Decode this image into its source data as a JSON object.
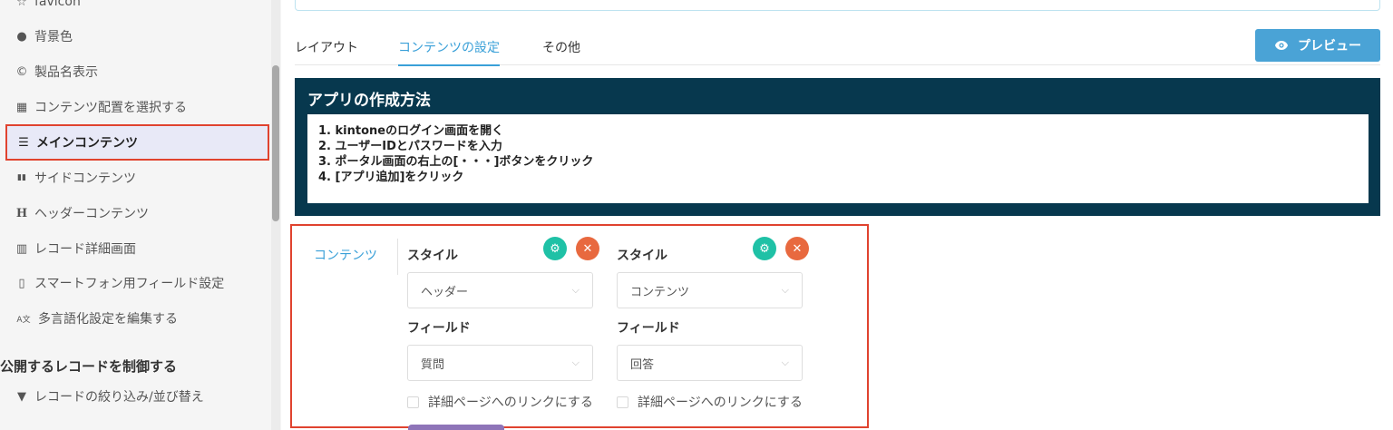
{
  "sidebar": {
    "items": [
      {
        "icon": "star-icon",
        "glyph": "☆",
        "label": "favicon"
      },
      {
        "icon": "droplet-icon",
        "glyph": "●",
        "label": "背景色"
      },
      {
        "icon": "copyright-icon",
        "glyph": "©",
        "label": "製品名表示"
      },
      {
        "icon": "grid-icon",
        "glyph": "▦",
        "label": "コンテンツ配置を選択する"
      },
      {
        "icon": "list-icon",
        "glyph": "☰",
        "label": "メインコンテンツ"
      },
      {
        "icon": "columns-icon",
        "glyph": "▮▮",
        "label": "サイドコンテンツ"
      },
      {
        "icon": "heading-icon",
        "glyph": "H",
        "label": "ヘッダーコンテンツ"
      },
      {
        "icon": "table-icon",
        "glyph": "▥",
        "label": "レコード詳細画面"
      },
      {
        "icon": "mobile-icon",
        "glyph": "▯",
        "label": "スマートフォン用フィールド設定"
      },
      {
        "icon": "translate-icon",
        "glyph": "A文",
        "label": "多言語化設定を編集する"
      }
    ],
    "section_heading": "公開するレコードを制御する",
    "filter_item": {
      "icon": "filter-icon",
      "glyph": "▼",
      "label": "レコードの絞り込み/並び替え"
    }
  },
  "tabs": [
    {
      "label": "レイアウト"
    },
    {
      "label": "コンテンツの設定"
    },
    {
      "label": "その他"
    }
  ],
  "preview_button": {
    "icon": "eye-icon",
    "label": "プレビュー"
  },
  "info": {
    "title": "アプリの作成方法",
    "steps": [
      "1. kintoneのログイン画面を開く",
      "2. ユーザーIDとパスワードを入力",
      "3. ポータル画面の右上の[・・・]ボタンをクリック",
      "4. [アプリ追加]をクリック"
    ]
  },
  "editor": {
    "label": "コンテンツ",
    "columns": [
      {
        "style_label": "スタイル",
        "style_value": "ヘッダー",
        "field_label": "フィールド",
        "field_value": "質問",
        "link_label": "詳細ページへのリンクにする"
      },
      {
        "style_label": "スタイル",
        "style_value": "コンテンツ",
        "field_label": "フィールド",
        "field_value": "回答",
        "link_label": "詳細ページへのリンクにする"
      }
    ]
  },
  "colors": {
    "accent": "#3aa0d8",
    "preview_button": "#4aa3d6",
    "info_panel": "#07384e",
    "highlight_border": "#e0432f",
    "gear_button": "#1fc1a6",
    "close_button": "#e8693f"
  }
}
